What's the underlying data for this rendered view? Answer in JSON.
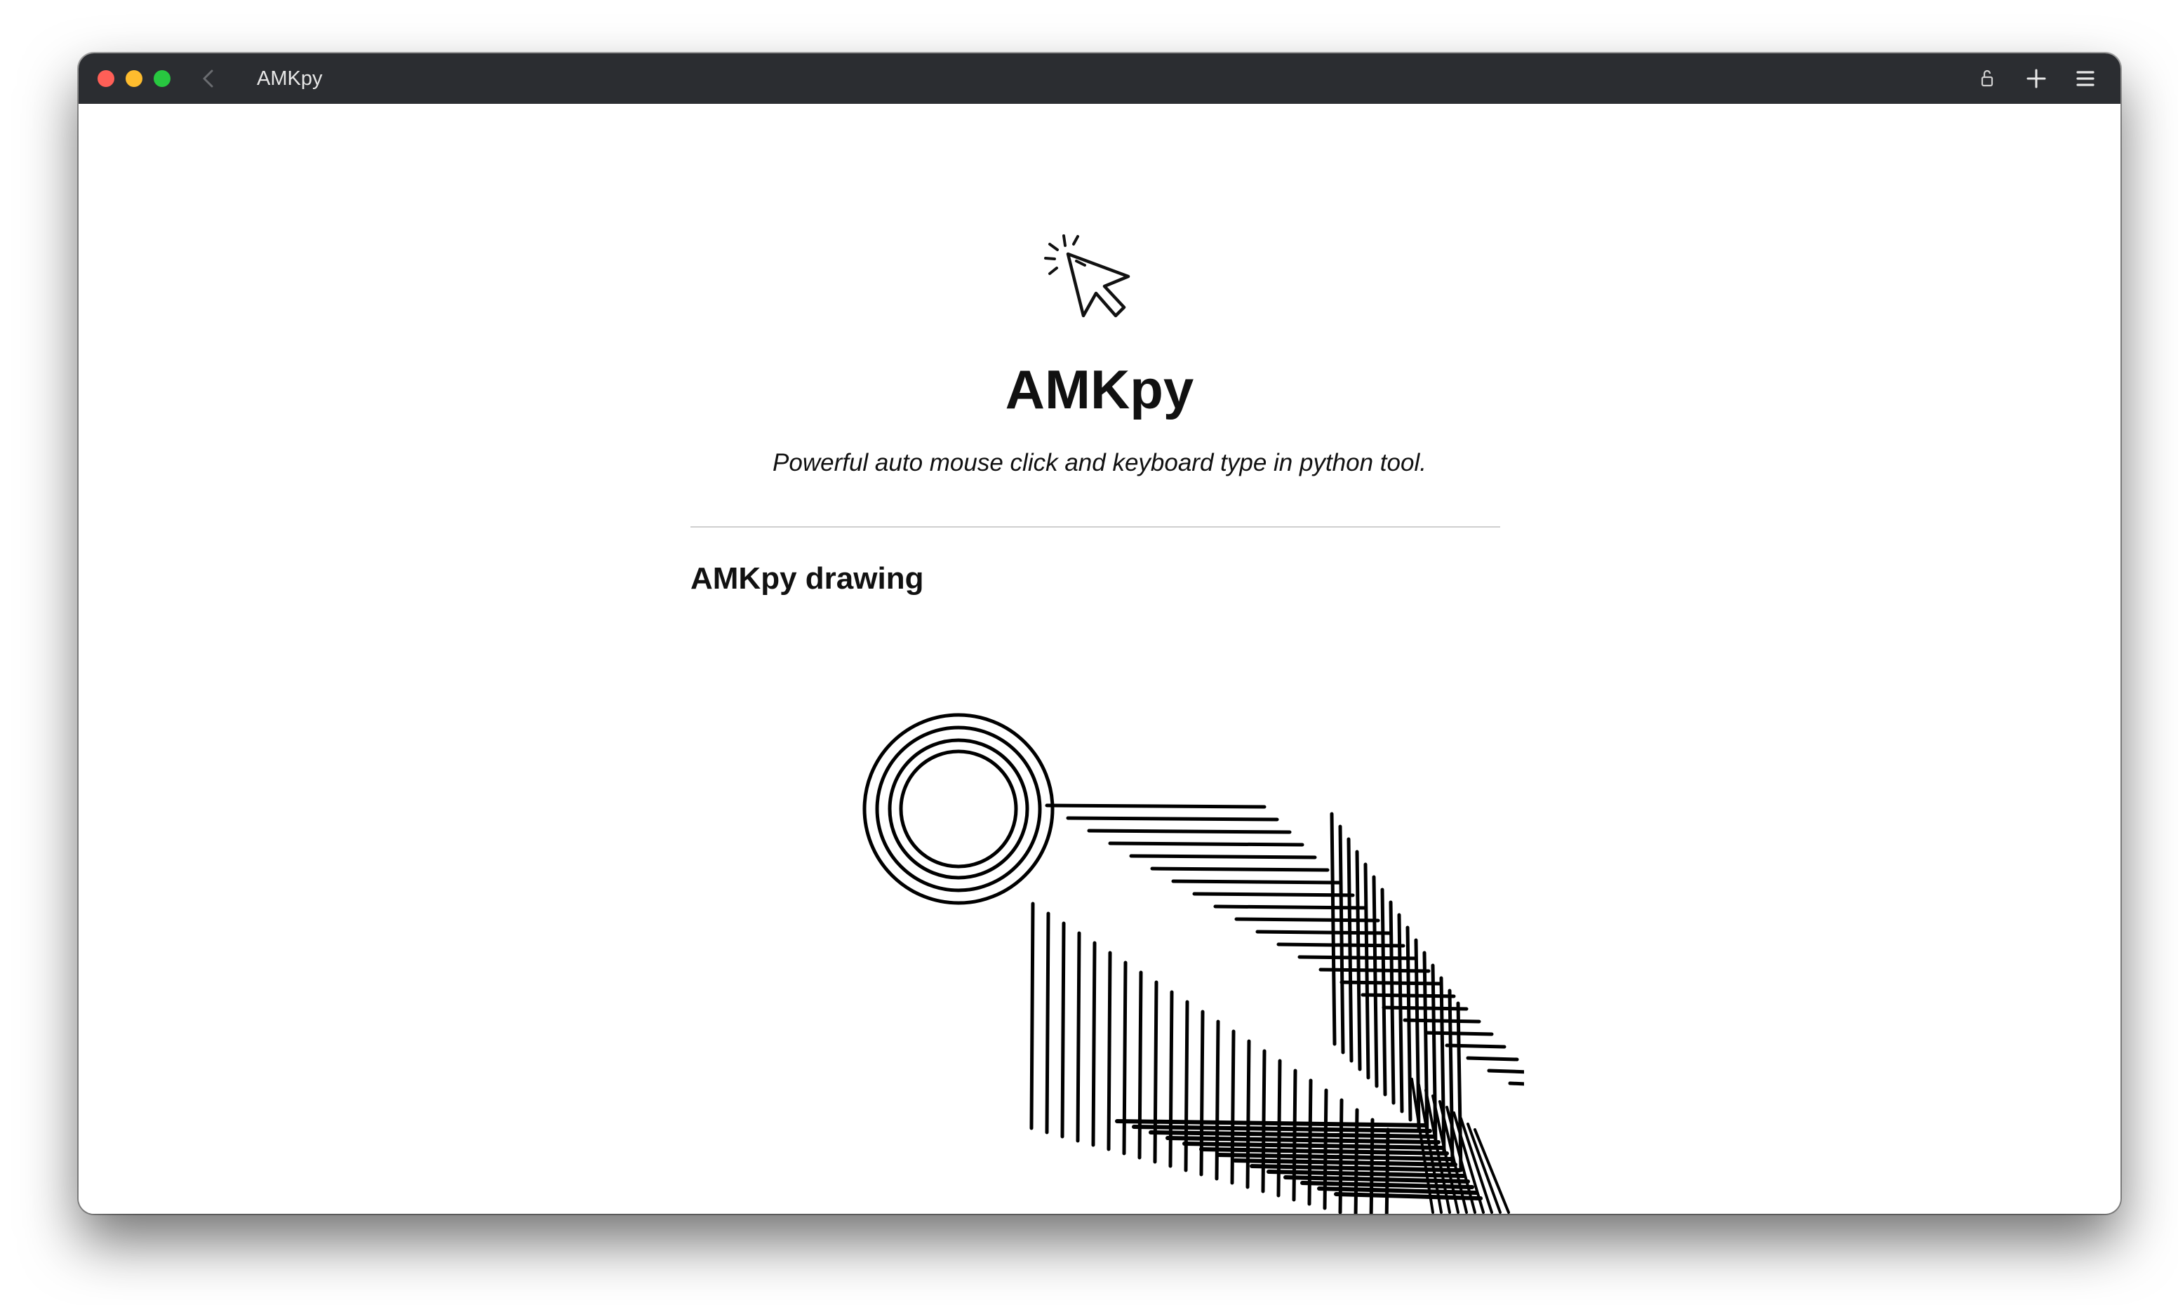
{
  "window": {
    "title": "AMKpy"
  },
  "toolbar": {
    "icons": [
      "chevron-left-icon",
      "lock-icon",
      "plus-icon",
      "hamburger-menu-icon"
    ]
  },
  "header": {
    "logo_icon": "cursor-click-icon",
    "title": "AMKpy",
    "tagline": "Powerful auto mouse click and keyboard type in python tool."
  },
  "section": {
    "heading": "AMKpy drawing",
    "image": "amkpy-drawing"
  },
  "colors": {
    "titlebar": "#2b2d31",
    "close": "#ff5f57",
    "minimize": "#febc2e",
    "maximize": "#28c840",
    "text": "#111111"
  }
}
